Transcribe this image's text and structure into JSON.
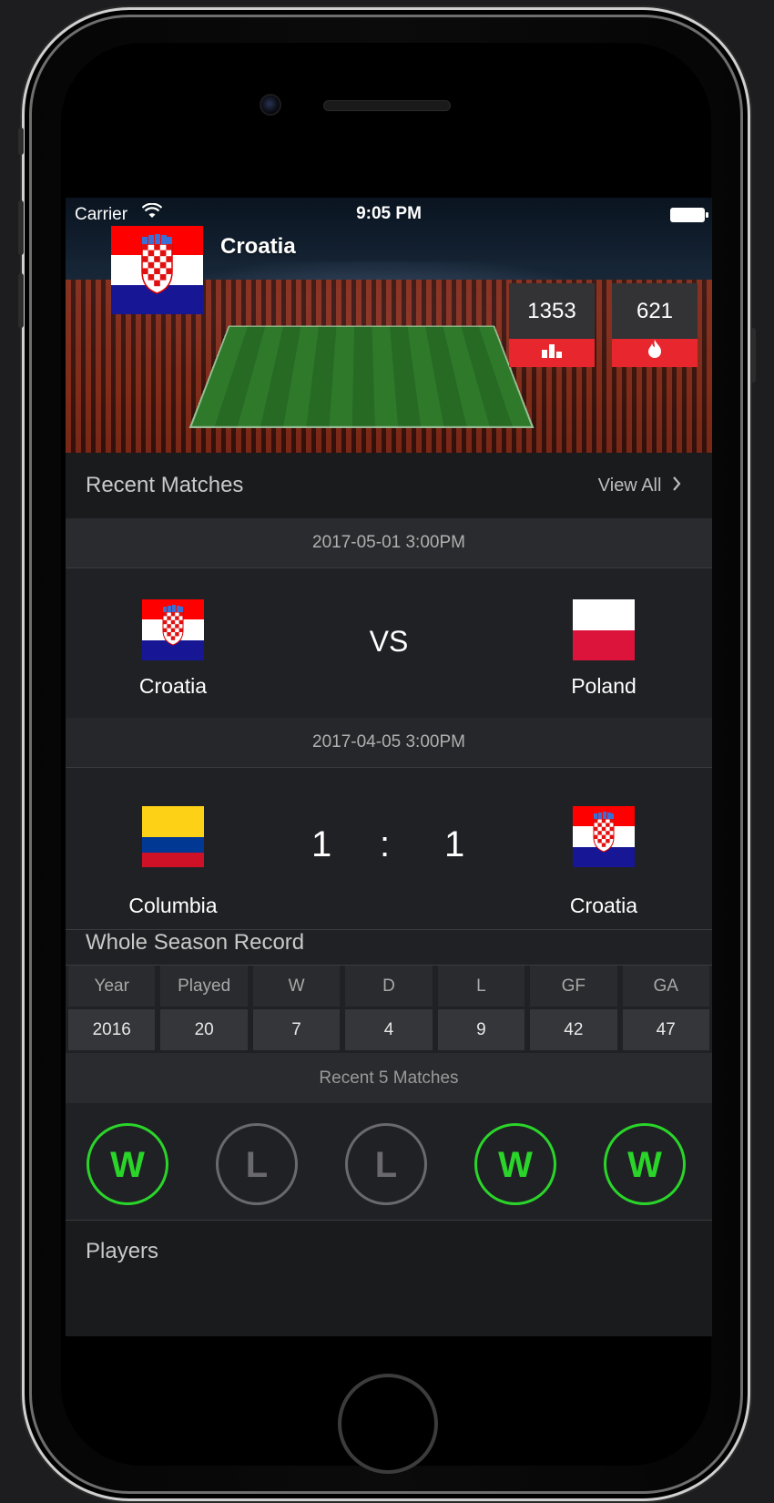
{
  "status_bar": {
    "carrier": "Carrier",
    "time": "9:05 PM"
  },
  "header": {
    "team_name": "Croatia",
    "stats": [
      {
        "value": "1353",
        "icon": "bar-chart-icon"
      },
      {
        "value": "621",
        "icon": "flame-icon"
      }
    ]
  },
  "recent_matches": {
    "title": "Recent Matches",
    "view_all": "View All",
    "matches": [
      {
        "date": "2017-05-01 3:00PM",
        "home": "Croatia",
        "away": "Poland",
        "center": "VS"
      },
      {
        "date": "2017-04-05 3:00PM",
        "home": "Columbia",
        "away": "Croatia",
        "home_score": "1",
        "separator": ":",
        "away_score": "1"
      }
    ]
  },
  "season_record": {
    "title": "Whole Season Record",
    "headers": [
      "Year",
      "Played",
      "W",
      "D",
      "L",
      "GF",
      "GA"
    ],
    "values": [
      "2016",
      "20",
      "7",
      "4",
      "9",
      "42",
      "47"
    ],
    "recent_label": "Recent 5 Matches",
    "recent_results": [
      "W",
      "L",
      "L",
      "W",
      "W"
    ]
  },
  "players": {
    "title": "Players"
  },
  "colors": {
    "accent_red": "#e8262d",
    "win_green": "#2ad52a",
    "loss_gray": "#6a6a6e"
  }
}
